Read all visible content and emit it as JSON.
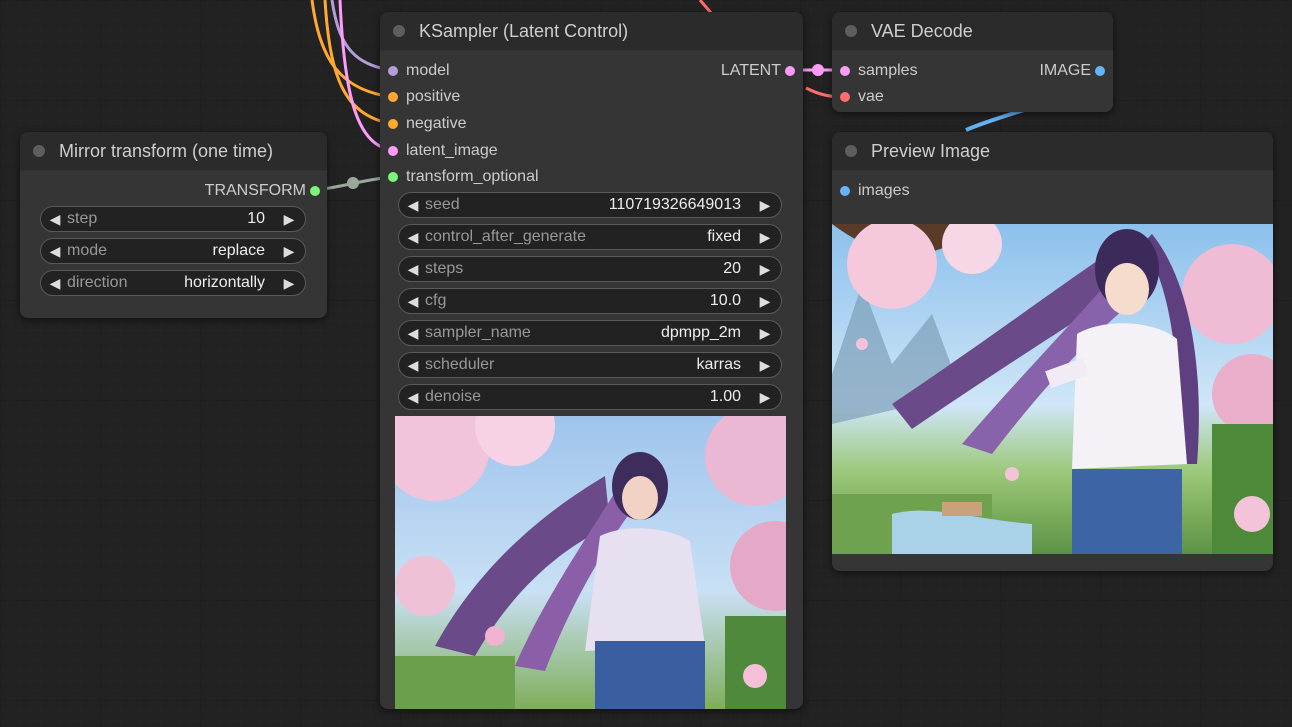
{
  "colors": {
    "canvas_bg": "#222222",
    "node_bg": "#353535",
    "node_title_bg": "#2b2b2b",
    "model_slot": "#b39ddb",
    "conditioning_slot": "#ffa931",
    "latent_slot": "#ff9cf9",
    "transform_slot": "#7cf57c",
    "vae_slot": "#ff6e6e",
    "image_slot": "#64b5f6"
  },
  "nodes": {
    "mirror": {
      "title": "Mirror transform (one time)",
      "output": "TRANSFORM",
      "widgets": [
        {
          "name": "step",
          "value": "10"
        },
        {
          "name": "mode",
          "value": "replace"
        },
        {
          "name": "direction",
          "value": "horizontally"
        }
      ]
    },
    "ksampler": {
      "title": "KSampler (Latent Control)",
      "inputs": [
        "model",
        "positive",
        "negative",
        "latent_image",
        "transform_optional"
      ],
      "output": "LATENT",
      "widgets": [
        {
          "name": "seed",
          "value": "110719326649013"
        },
        {
          "name": "control_after_generate",
          "value": "fixed"
        },
        {
          "name": "steps",
          "value": "20"
        },
        {
          "name": "cfg",
          "value": "10.0"
        },
        {
          "name": "sampler_name",
          "value": "dpmpp_2m"
        },
        {
          "name": "scheduler",
          "value": "karras"
        },
        {
          "name": "denoise",
          "value": "1.00"
        }
      ]
    },
    "vae_decode": {
      "title": "VAE Decode",
      "inputs": [
        "samples",
        "vae"
      ],
      "output": "IMAGE"
    },
    "preview": {
      "title": "Preview Image",
      "inputs": [
        "images"
      ]
    }
  },
  "icons": {
    "decrement": "◀",
    "increment": "▶"
  }
}
